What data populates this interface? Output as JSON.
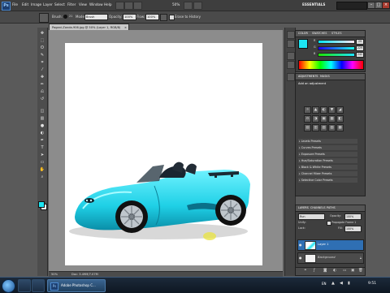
{
  "app": {
    "logo": "Ps",
    "menus": [
      "File",
      "Edit",
      "Image",
      "Layer",
      "Select",
      "Filter",
      "View",
      "Window",
      "Help"
    ],
    "zoom": "50%",
    "workspace": "ESSENTIALS",
    "window_buttons": [
      "–",
      "□",
      "×"
    ]
  },
  "options_bar": {
    "brush_label": "Brush:",
    "brush_size": "21",
    "mode_label": "Mode:",
    "mode_value": "Brush",
    "opacity_label": "Opacity:",
    "opacity_value": "100%",
    "flow_label": "Flow:",
    "flow_value": "100%",
    "erase_history_label": "Erase to History"
  },
  "document": {
    "tab_title": "Pagani-Zonda-906.jpg @ 50% (Layer 1, RGB/8)",
    "close": "×",
    "status_zoom": "50%",
    "status_doc": "Doc: 3.49M/7.07M"
  },
  "tools": {
    "icons": [
      "move-icon",
      "marquee-icon",
      "lasso-icon",
      "quick-select-icon",
      "crop-icon",
      "eyedropper-icon",
      "healing-icon",
      "brush-icon",
      "clone-stamp-icon",
      "history-brush-icon",
      "eraser-icon",
      "gradient-icon",
      "blur-icon",
      "dodge-icon",
      "pen-icon",
      "type-icon",
      "path-select-icon",
      "shape-icon",
      "hand-icon",
      "zoom-icon"
    ],
    "glyphs": [
      "✥",
      "⬚",
      "ʘ",
      "✎",
      "⌗",
      "⁄",
      "✚",
      "✏",
      "⎌",
      "↺",
      "◫",
      "▥",
      "●",
      "◐",
      "✒",
      "T",
      "➤",
      "▭",
      "✋",
      "⌕"
    ]
  },
  "color_panel": {
    "tabs": [
      "COLOR",
      "SWATCHES",
      "STYLES"
    ],
    "channels": [
      {
        "label": "R",
        "value": "29"
      },
      {
        "label": "G",
        "value": "229"
      },
      {
        "label": "B",
        "value": "242"
      }
    ],
    "foreground_color": "#1de5f2"
  },
  "adjustments_panel": {
    "tabs": [
      "ADJUSTMENTS",
      "MASKS"
    ],
    "heading": "Add an adjustment",
    "icons_row1": [
      "☼",
      "▲",
      "◐",
      "▼",
      "◢"
    ],
    "icons_row2": [
      "⚖",
      "◑",
      "▣",
      "▦",
      "◧"
    ],
    "icons_row3": [
      "▤",
      "▥",
      "▨",
      "▧",
      "▩"
    ],
    "presets": [
      "Levels Presets",
      "Curves Presets",
      "Exposure Presets",
      "Hue/Saturation Presets",
      "Black & White Presets",
      "Channel Mixer Presets",
      "Selective Color Presets"
    ]
  },
  "layers_panel": {
    "tabs": [
      "LAYERS",
      "CHANNELS",
      "PATHS"
    ],
    "blend_mode": "Run",
    "opacity_label": "Opacity:",
    "opacity_value": "100%",
    "unify_label": "Unify:",
    "propagate_label": "Propagate Frame 1",
    "lock_label": "Lock:",
    "fill_label": "Fill:",
    "fill_value": "100%",
    "layers": [
      {
        "name": "Layer 1",
        "selected": true
      },
      {
        "name": "Background",
        "selected": false
      }
    ]
  },
  "taskbar": {
    "active_app": "Adobe Photoshop C...",
    "tray_lang": "EN",
    "clock": "9:51"
  },
  "colors": {
    "accent": "#1de5f2",
    "layer_selected": "#2f6fb3"
  }
}
